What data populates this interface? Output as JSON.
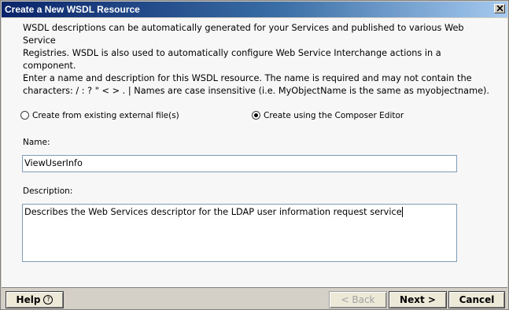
{
  "window": {
    "title": "Create a New WSDL Resource",
    "close_icon": "close-icon"
  },
  "description": {
    "line1": "WSDL descriptions can be automatically generated for your Services and published to various Web Service",
    "line2": "Registries.  WSDL is also used to automatically configure Web Service Interchange actions in a component.",
    "line3": "Enter a name and description for this WSDL resource.  The name is required and may not contain the",
    "line4": "characters:  / : ? \" < > . |  Names are case insensitive (i.e. MyObjectName is the same as myobjectname)."
  },
  "options": {
    "external_label": "Create from existing external file(s)",
    "external_selected": false,
    "composer_label": "Create using the Composer Editor",
    "composer_selected": true
  },
  "name_field": {
    "label": "Name:",
    "value": "ViewUserInfo"
  },
  "description_field": {
    "label": "Description:",
    "value": "Describes the Web Services descriptor for the LDAP user information request service"
  },
  "buttons": {
    "help": "Help",
    "help_icon": "?",
    "back": "< Back",
    "next": "Next >",
    "cancel": "Cancel"
  }
}
